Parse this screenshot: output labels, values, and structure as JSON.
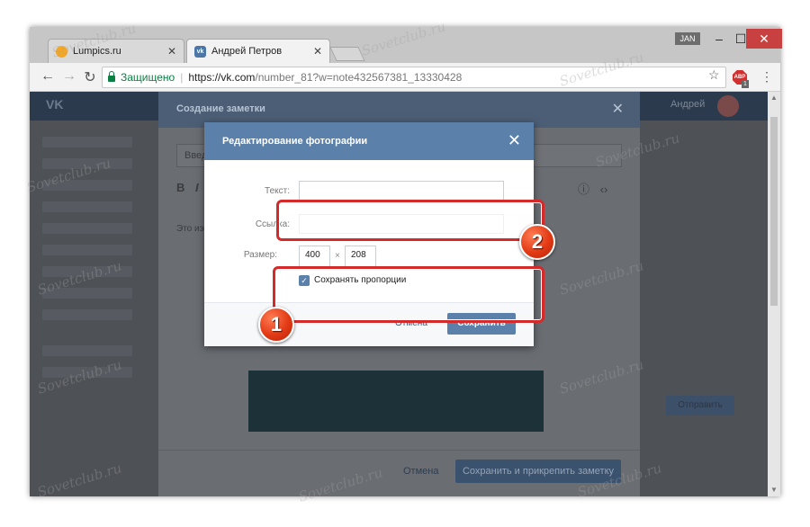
{
  "browser": {
    "tabs": [
      {
        "title": "Lumpics.ru",
        "favicon_color": "#f5a623",
        "active": false
      },
      {
        "title": "Андрей Петров",
        "favicon_color": "#4a76a8",
        "active": true
      }
    ],
    "lang": "JAN",
    "secure_label": "Защищено",
    "url_host": "https://vk.com",
    "url_rest": "/number_81?w=note432567381_13330428",
    "adblock_label": "ABP",
    "adblock_count": "1"
  },
  "background": {
    "user_name": "Андрей",
    "note_title": "Создание заметки",
    "note_input_placeholder": "Введите на",
    "note_body_text": "Это изображ",
    "note_cancel": "Отмена",
    "note_save": "Сохранить и прикрепить заметку",
    "send_label": "Отправить"
  },
  "dialog": {
    "title": "Редактирование фотографии",
    "text_label": "Текст:",
    "text_value": "",
    "link_label": "Ссылка:",
    "size_label": "Размер:",
    "width": "400",
    "height": "208",
    "times": "×",
    "keep_proportions": "Сохранять пропорции",
    "keep_proportions_checked": true,
    "cancel": "Отмена",
    "save": "Сохранить"
  },
  "annotations": {
    "badge_1": "1",
    "badge_2": "2",
    "highlight_color": "#d42a2a"
  },
  "watermark": "Sovetclub.ru"
}
